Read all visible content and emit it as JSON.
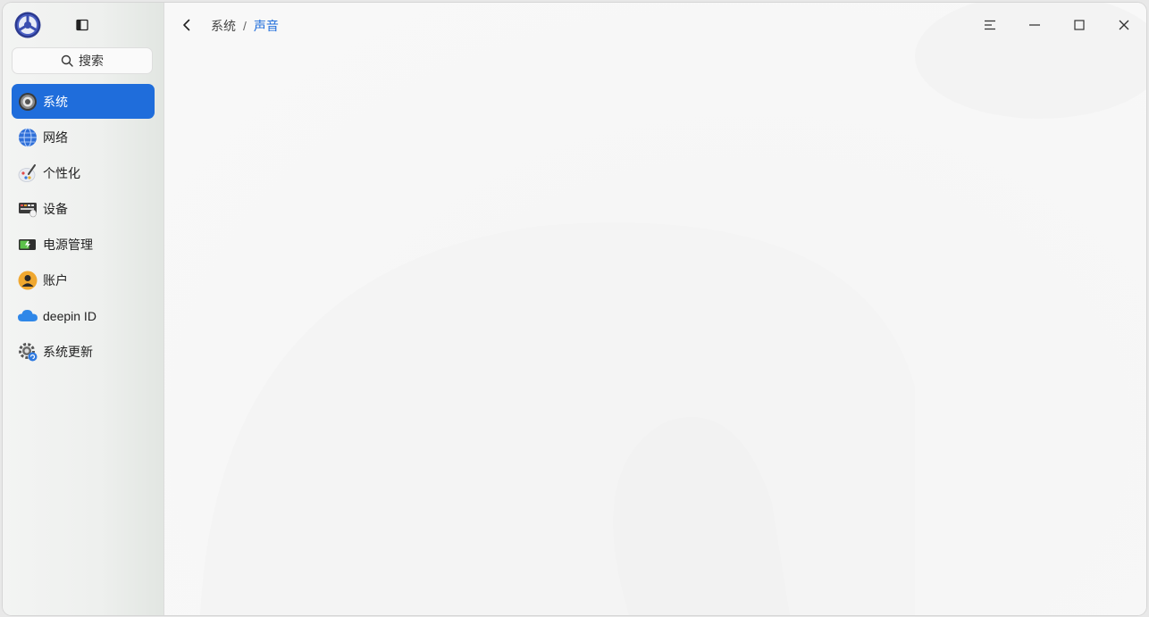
{
  "sidebar": {
    "search_label": "搜索",
    "items": [
      {
        "label": "系统",
        "icon": "system-icon",
        "active": true
      },
      {
        "label": "网络",
        "icon": "network-icon",
        "active": false
      },
      {
        "label": "个性化",
        "icon": "personalization-icon",
        "active": false
      },
      {
        "label": "设备",
        "icon": "device-icon",
        "active": false
      },
      {
        "label": "电源管理",
        "icon": "power-icon",
        "active": false
      },
      {
        "label": "账户",
        "icon": "account-icon",
        "active": false
      },
      {
        "label": "deepin ID",
        "icon": "cloud-icon",
        "active": false
      },
      {
        "label": "系统更新",
        "icon": "update-icon",
        "active": false
      }
    ]
  },
  "breadcrumb": {
    "parent": "系统",
    "separator": "/",
    "current": "声音"
  },
  "colors": {
    "accent": "#1f6ddb"
  }
}
